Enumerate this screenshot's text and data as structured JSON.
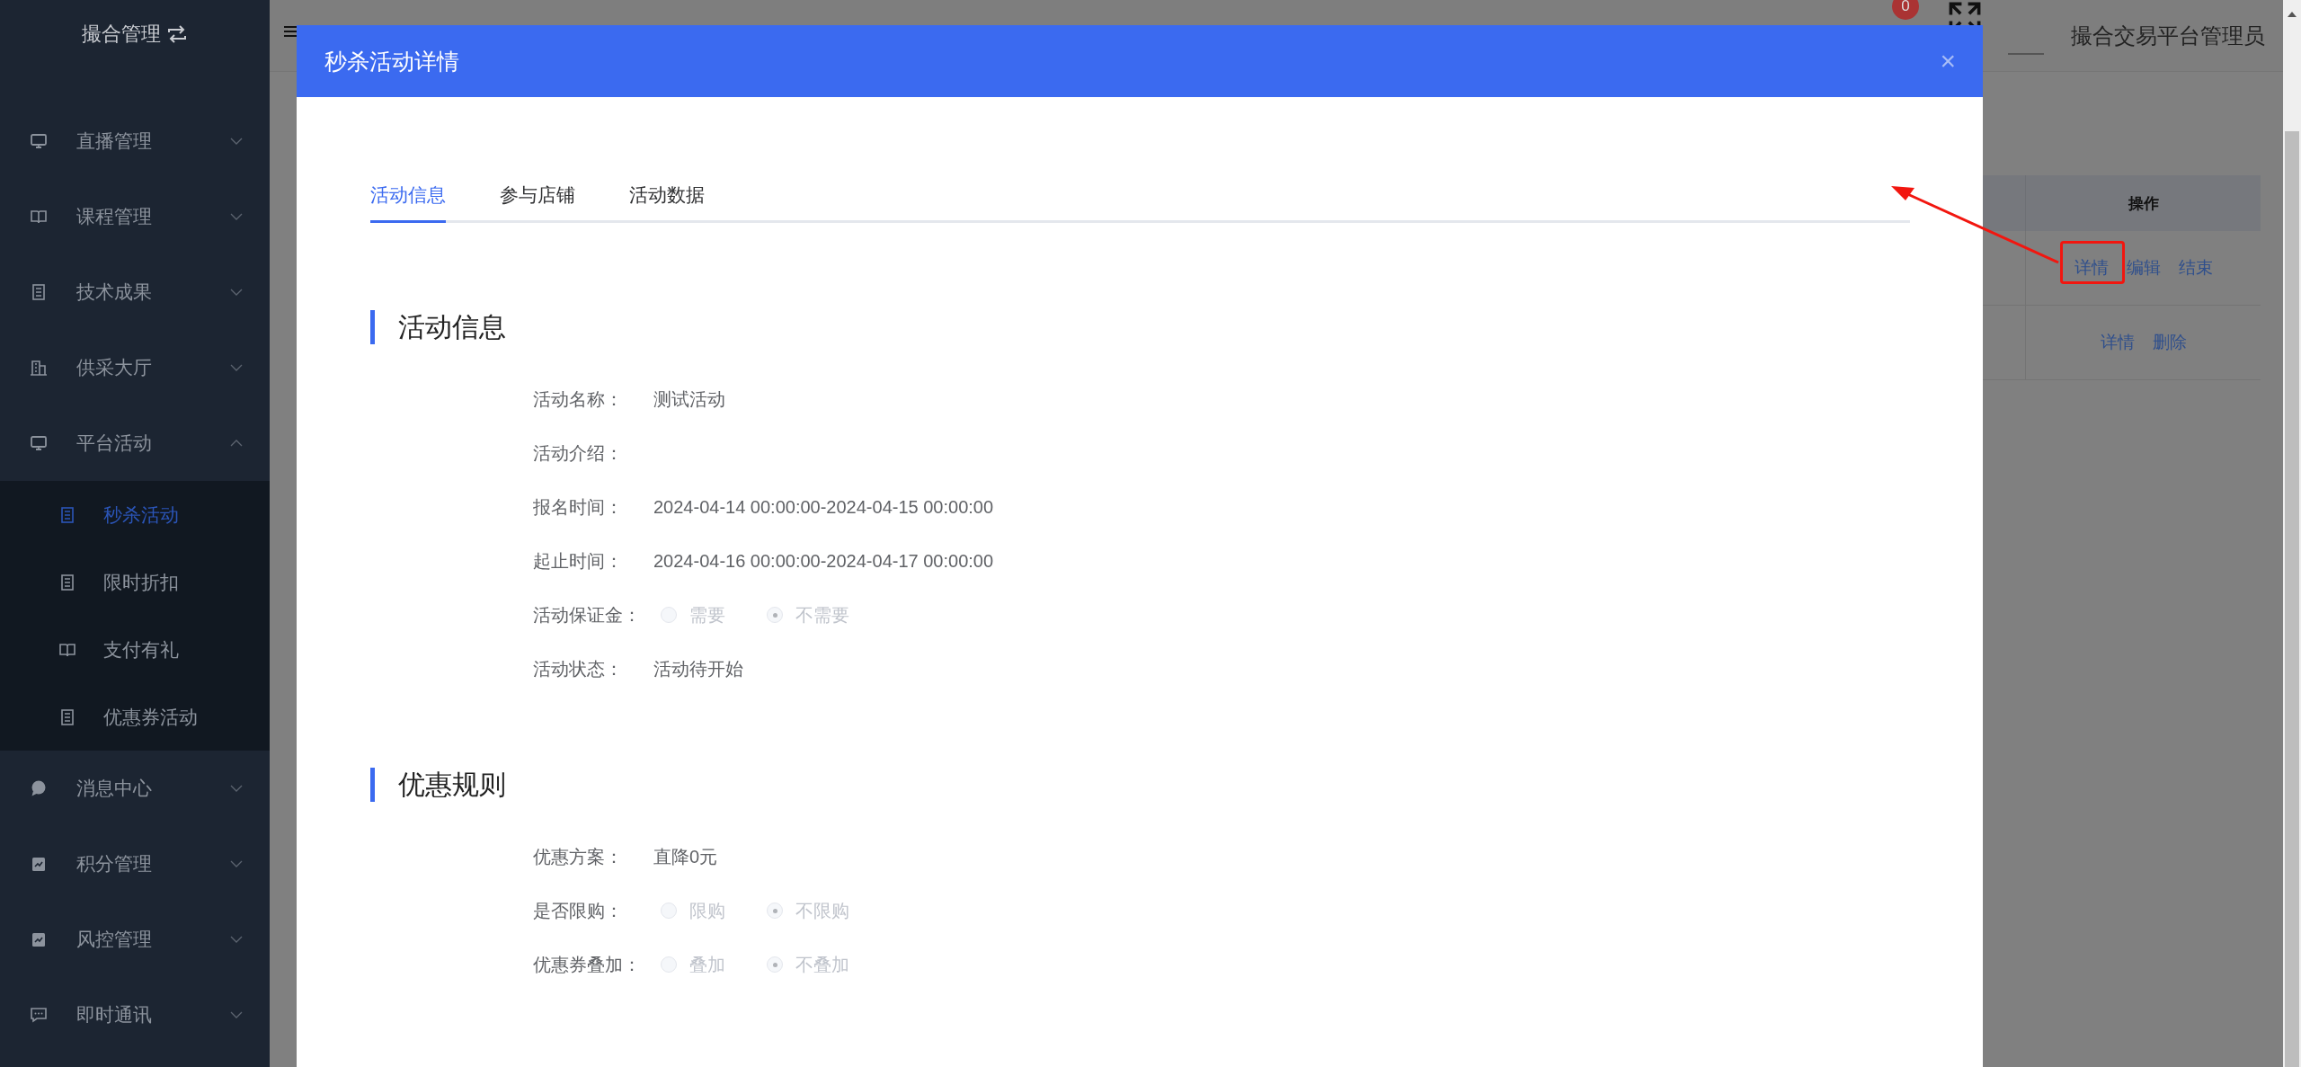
{
  "sidebar": {
    "title": "撮合管理",
    "items": [
      {
        "label": "直播管理",
        "expanded": false
      },
      {
        "label": "课程管理",
        "expanded": false
      },
      {
        "label": "技术成果",
        "expanded": false
      },
      {
        "label": "供采大厅",
        "expanded": false
      },
      {
        "label": "平台活动",
        "expanded": true,
        "children": [
          {
            "label": "秒杀活动",
            "selected": true
          },
          {
            "label": "限时折扣",
            "selected": false
          },
          {
            "label": "支付有礼",
            "selected": false
          },
          {
            "label": "优惠券活动",
            "selected": false
          }
        ]
      },
      {
        "label": "消息中心",
        "expanded": false
      },
      {
        "label": "积分管理",
        "expanded": false
      },
      {
        "label": "风控管理",
        "expanded": false
      },
      {
        "label": "即时通讯",
        "expanded": false
      }
    ]
  },
  "header": {
    "notification_count": "0",
    "user_name": "撮合交易平台管理员"
  },
  "table": {
    "columns": [
      "操作"
    ],
    "rows": [
      {
        "actions": [
          "详情",
          "编辑",
          "结束"
        ]
      },
      {
        "actions": [
          "详情",
          "删除"
        ]
      }
    ]
  },
  "dialog": {
    "title": "秒杀活动详情",
    "close": "×",
    "tabs": [
      {
        "label": "活动信息",
        "selected": true
      },
      {
        "label": "参与店铺",
        "selected": false
      },
      {
        "label": "活动数据",
        "selected": false
      }
    ],
    "sections": [
      {
        "title": "活动信息",
        "fields": [
          {
            "kind": "text",
            "label": "活动名称：",
            "value": "测试活动"
          },
          {
            "kind": "text",
            "label": "活动介绍："
          },
          {
            "kind": "text",
            "label": "报名时间：",
            "value": "2024-04-14 00:00:00-2024-04-15 00:00:00"
          },
          {
            "kind": "text",
            "label": "起止时间：",
            "value": "2024-04-16 00:00:00-2024-04-17 00:00:00"
          },
          {
            "kind": "radio",
            "label": "活动保证金：",
            "disabled": true,
            "options": [
              {
                "label": "需要",
                "selected": false
              },
              {
                "label": "不需要",
                "selected": true
              }
            ]
          },
          {
            "kind": "text",
            "label": "活动状态：",
            "value": "活动待开始"
          }
        ]
      },
      {
        "title": "优惠规则",
        "fields": [
          {
            "kind": "text",
            "label": "优惠方案：",
            "value": "直降0元"
          },
          {
            "kind": "radio",
            "label": "是否限购：",
            "disabled": true,
            "options": [
              {
                "label": "限购",
                "selected": false
              },
              {
                "label": "不限购",
                "selected": true
              }
            ]
          },
          {
            "kind": "radio",
            "label": "优惠券叠加：",
            "disabled": true,
            "options": [
              {
                "label": "叠加",
                "selected": false
              },
              {
                "label": "不叠加",
                "selected": true
              }
            ]
          }
        ]
      }
    ]
  }
}
